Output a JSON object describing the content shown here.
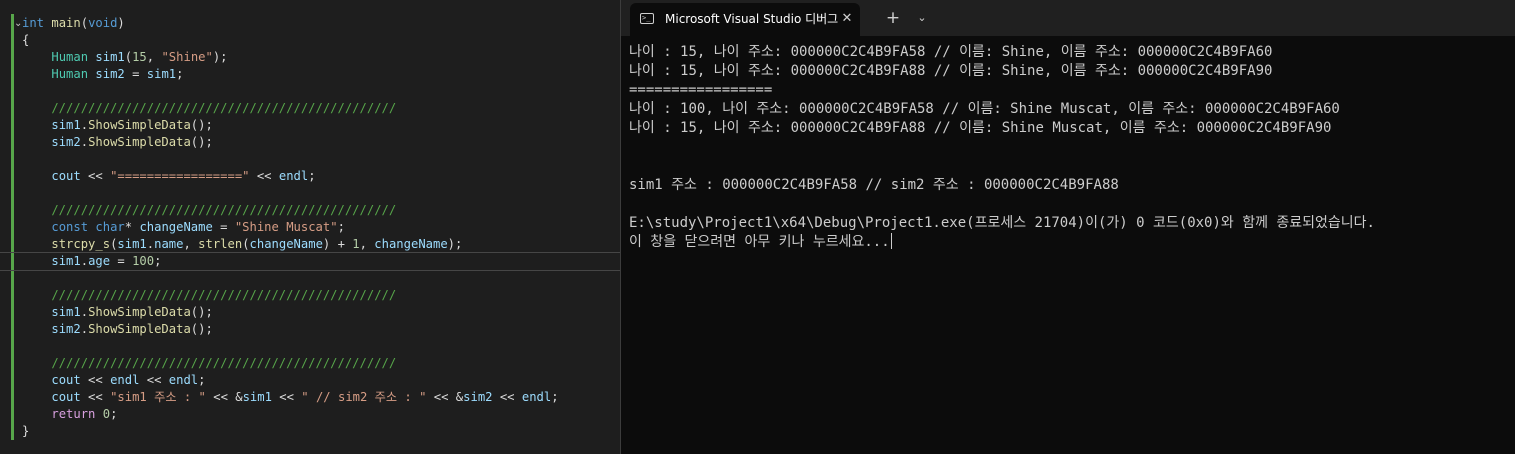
{
  "editor": {
    "fold_toggle": "⌄",
    "lines": [
      [
        {
          "t": "int",
          "c": "keyword"
        },
        {
          "t": " ",
          "c": "plain"
        },
        {
          "t": "main",
          "c": "func"
        },
        {
          "t": "(",
          "c": "plain"
        },
        {
          "t": "void",
          "c": "keyword"
        },
        {
          "t": ")",
          "c": "plain"
        }
      ],
      [
        {
          "t": "{",
          "c": "plain"
        }
      ],
      [
        {
          "t": "    ",
          "c": "plain"
        },
        {
          "t": "Human",
          "c": "type"
        },
        {
          "t": " ",
          "c": "plain"
        },
        {
          "t": "sim1",
          "c": "var"
        },
        {
          "t": "(",
          "c": "plain"
        },
        {
          "t": "15",
          "c": "number"
        },
        {
          "t": ", ",
          "c": "plain"
        },
        {
          "t": "\"Shine\"",
          "c": "string"
        },
        {
          "t": ");",
          "c": "plain"
        }
      ],
      [
        {
          "t": "    ",
          "c": "plain"
        },
        {
          "t": "Human",
          "c": "type"
        },
        {
          "t": " ",
          "c": "plain"
        },
        {
          "t": "sim2",
          "c": "var"
        },
        {
          "t": " = ",
          "c": "plain"
        },
        {
          "t": "sim1",
          "c": "var"
        },
        {
          "t": ";",
          "c": "plain"
        }
      ],
      [],
      [
        {
          "t": "    ///////////////////////////////////////////////",
          "c": "comment"
        }
      ],
      [
        {
          "t": "    ",
          "c": "plain"
        },
        {
          "t": "sim1",
          "c": "var"
        },
        {
          "t": ".",
          "c": "plain"
        },
        {
          "t": "ShowSimpleData",
          "c": "func"
        },
        {
          "t": "();",
          "c": "plain"
        }
      ],
      [
        {
          "t": "    ",
          "c": "plain"
        },
        {
          "t": "sim2",
          "c": "var"
        },
        {
          "t": ".",
          "c": "plain"
        },
        {
          "t": "ShowSimpleData",
          "c": "func"
        },
        {
          "t": "();",
          "c": "plain"
        }
      ],
      [],
      [
        {
          "t": "    ",
          "c": "plain"
        },
        {
          "t": "cout",
          "c": "var"
        },
        {
          "t": " << ",
          "c": "plain"
        },
        {
          "t": "\"=================\"",
          "c": "string"
        },
        {
          "t": " << ",
          "c": "plain"
        },
        {
          "t": "endl",
          "c": "var"
        },
        {
          "t": ";",
          "c": "plain"
        }
      ],
      [],
      [
        {
          "t": "    ///////////////////////////////////////////////",
          "c": "comment"
        }
      ],
      [
        {
          "t": "    ",
          "c": "plain"
        },
        {
          "t": "const",
          "c": "keyword"
        },
        {
          "t": " ",
          "c": "plain"
        },
        {
          "t": "char",
          "c": "keyword"
        },
        {
          "t": "* ",
          "c": "plain"
        },
        {
          "t": "changeName",
          "c": "var"
        },
        {
          "t": " = ",
          "c": "plain"
        },
        {
          "t": "\"Shine Muscat\"",
          "c": "string"
        },
        {
          "t": ";",
          "c": "plain"
        }
      ],
      [
        {
          "t": "    ",
          "c": "plain"
        },
        {
          "t": "strcpy_s",
          "c": "func"
        },
        {
          "t": "(",
          "c": "plain"
        },
        {
          "t": "sim1",
          "c": "var"
        },
        {
          "t": ".",
          "c": "plain"
        },
        {
          "t": "name",
          "c": "var"
        },
        {
          "t": ", ",
          "c": "plain"
        },
        {
          "t": "strlen",
          "c": "func"
        },
        {
          "t": "(",
          "c": "plain"
        },
        {
          "t": "changeName",
          "c": "var"
        },
        {
          "t": ") + ",
          "c": "plain"
        },
        {
          "t": "1",
          "c": "number"
        },
        {
          "t": ", ",
          "c": "plain"
        },
        {
          "t": "changeName",
          "c": "var"
        },
        {
          "t": ");",
          "c": "plain"
        }
      ],
      [
        {
          "t": "    ",
          "c": "plain"
        },
        {
          "t": "sim1",
          "c": "var"
        },
        {
          "t": ".",
          "c": "plain"
        },
        {
          "t": "age",
          "c": "var"
        },
        {
          "t": " = ",
          "c": "plain"
        },
        {
          "t": "100",
          "c": "number"
        },
        {
          "t": ";",
          "c": "plain"
        }
      ],
      [],
      [
        {
          "t": "    ///////////////////////////////////////////////",
          "c": "comment"
        }
      ],
      [
        {
          "t": "    ",
          "c": "plain"
        },
        {
          "t": "sim1",
          "c": "var"
        },
        {
          "t": ".",
          "c": "plain"
        },
        {
          "t": "ShowSimpleData",
          "c": "func"
        },
        {
          "t": "();",
          "c": "plain"
        }
      ],
      [
        {
          "t": "    ",
          "c": "plain"
        },
        {
          "t": "sim2",
          "c": "var"
        },
        {
          "t": ".",
          "c": "plain"
        },
        {
          "t": "ShowSimpleData",
          "c": "func"
        },
        {
          "t": "();",
          "c": "plain"
        }
      ],
      [],
      [
        {
          "t": "    ///////////////////////////////////////////////",
          "c": "comment"
        }
      ],
      [
        {
          "t": "    ",
          "c": "plain"
        },
        {
          "t": "cout",
          "c": "var"
        },
        {
          "t": " << ",
          "c": "plain"
        },
        {
          "t": "endl",
          "c": "var"
        },
        {
          "t": " << ",
          "c": "plain"
        },
        {
          "t": "endl",
          "c": "var"
        },
        {
          "t": ";",
          "c": "plain"
        }
      ],
      [
        {
          "t": "    ",
          "c": "plain"
        },
        {
          "t": "cout",
          "c": "var"
        },
        {
          "t": " << ",
          "c": "plain"
        },
        {
          "t": "\"sim1 주소 : \"",
          "c": "string"
        },
        {
          "t": " << &",
          "c": "plain"
        },
        {
          "t": "sim1",
          "c": "var"
        },
        {
          "t": " << ",
          "c": "plain"
        },
        {
          "t": "\" // sim2 주소 : \"",
          "c": "string"
        },
        {
          "t": " << &",
          "c": "plain"
        },
        {
          "t": "sim2",
          "c": "var"
        },
        {
          "t": " << ",
          "c": "plain"
        },
        {
          "t": "endl",
          "c": "var"
        },
        {
          "t": ";",
          "c": "plain"
        }
      ],
      [
        {
          "t": "    ",
          "c": "plain"
        },
        {
          "t": "return",
          "c": "control"
        },
        {
          "t": " ",
          "c": "plain"
        },
        {
          "t": "0",
          "c": "number"
        },
        {
          "t": ";",
          "c": "plain"
        }
      ],
      [
        {
          "t": "}",
          "c": "plain"
        }
      ]
    ],
    "current_line_index": 14
  },
  "terminal": {
    "tab_icon_glyph": ">_",
    "tab_title": "Microsoft Visual Studio 디버그",
    "close_glyph": "✕",
    "new_tab_glyph": "+",
    "dropdown_glyph": "⌄",
    "lines": [
      "나이 : 15, 나이 주소: 000000C2C4B9FA58 // 이름: Shine, 이름 주소: 000000C2C4B9FA60",
      "나이 : 15, 나이 주소: 000000C2C4B9FA88 // 이름: Shine, 이름 주소: 000000C2C4B9FA90",
      "=================",
      "나이 : 100, 나이 주소: 000000C2C4B9FA58 // 이름: Shine Muscat, 이름 주소: 000000C2C4B9FA60",
      "나이 : 15, 나이 주소: 000000C2C4B9FA88 // 이름: Shine Muscat, 이름 주소: 000000C2C4B9FA90",
      "",
      "",
      "sim1 주소 : 000000C2C4B9FA58 // sim2 주소 : 000000C2C4B9FA88",
      "",
      "E:\\study\\Project1\\x64\\Debug\\Project1.exe(프로세스 21704)이(가) 0 코드(0x0)와 함께 종료되었습니다.",
      "이 창을 닫으려면 아무 키나 누르세요..."
    ]
  }
}
